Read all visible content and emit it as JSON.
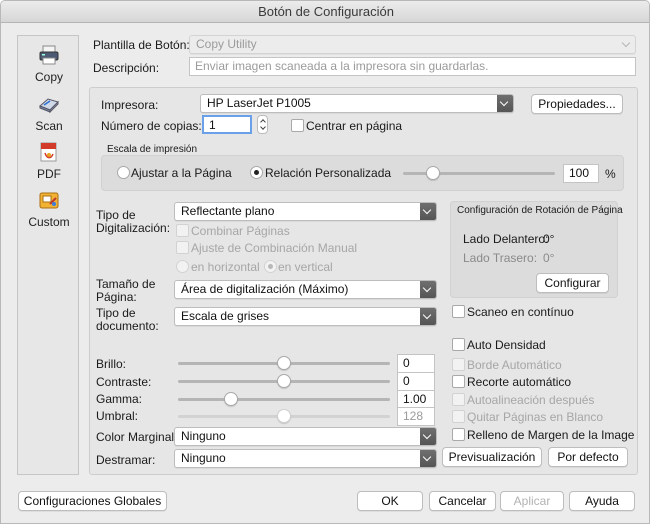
{
  "window": {
    "title": "Botón de Configuración"
  },
  "sidebar": {
    "items": [
      {
        "label": "Copy",
        "icon": "printer-icon",
        "selected": true
      },
      {
        "label": "Scan",
        "icon": "scanner-icon"
      },
      {
        "label": "PDF",
        "icon": "pdf-icon"
      },
      {
        "label": "Custom",
        "icon": "custom-icon"
      }
    ]
  },
  "header": {
    "template_label": "Plantilla de Botón:",
    "template_value": "Copy Utility",
    "description_label": "Descripción:",
    "description_value": "Enviar imagen scaneada a la impresora sin guardarlas."
  },
  "printer": {
    "printer_label": "Impresora:",
    "printer_value": "HP LaserJet P1005",
    "properties_button": "Propiedades...",
    "copies_label": "Número de copias:",
    "copies_value": "1",
    "center_label": "Centrar en página",
    "center_checked": false
  },
  "print_scale": {
    "title": "Escala de impresión",
    "fit_label": "Ajustar a la Página",
    "fit_selected": false,
    "custom_label": "Relación Personalizada",
    "custom_selected": true,
    "percent_value": "100",
    "percent_unit": "%",
    "slider_fraction": 0.2
  },
  "scan": {
    "scan_type_label": "Tipo de Digitalización:",
    "scan_type_label_1": "Tipo de",
    "scan_type_label_2": "Digitalización:",
    "scan_type_value": "Reflectante plano",
    "combine_pages_label": "Combinar Páginas",
    "manual_combine_label": "Ajuste de Combinación Manual",
    "horizontal_label": "en horizontal",
    "vertical_label": "en vertical",
    "vertical_selected": true,
    "page_size_label_1": "Tamaño de",
    "page_size_label_2": "Página:",
    "page_size_value": "Área de digitalización (Máximo)",
    "doc_type_label_1": "Tipo de",
    "doc_type_label_2": "documento:",
    "doc_type_value": "Escala de grises"
  },
  "rotation": {
    "title": "Configuración de Rotación de Página",
    "front_label": "Lado Delantero:",
    "front_value": "0°",
    "back_label": "Lado Trasero:",
    "back_value": "0°",
    "configure_button": "Configurar"
  },
  "adjustments": {
    "brightness_label": "Brillo:",
    "brightness_value": "0",
    "brightness_fraction": 0.5,
    "contrast_label": "Contraste:",
    "contrast_value": "0",
    "contrast_fraction": 0.5,
    "gamma_label": "Gamma:",
    "gamma_value": "1.00",
    "gamma_fraction": 0.25,
    "threshold_label": "Umbral:",
    "threshold_value": "128",
    "threshold_fraction": 0.5,
    "margin_color_label": "Color Marginal:",
    "margin_color_value": "Ninguno",
    "descreen_label": "Destramar:",
    "descreen_value": "Ninguno"
  },
  "options": {
    "continuous_scan": "Scaneo en contínuo",
    "auto_density": "Auto Densidad",
    "auto_border": "Borde Automático",
    "auto_crop": "Recorte automático",
    "auto_deskew": "Autoalineación después",
    "remove_blank": "Quitar Páginas en Blanco",
    "fill_margin": "Relleno de Margen de la Image",
    "preview_button": "Previsualización",
    "default_button": "Por defecto"
  },
  "footer": {
    "global_settings": "Configuraciones Globales",
    "ok": "OK",
    "cancel": "Cancelar",
    "apply": "Aplicar",
    "help": "Ayuda"
  }
}
